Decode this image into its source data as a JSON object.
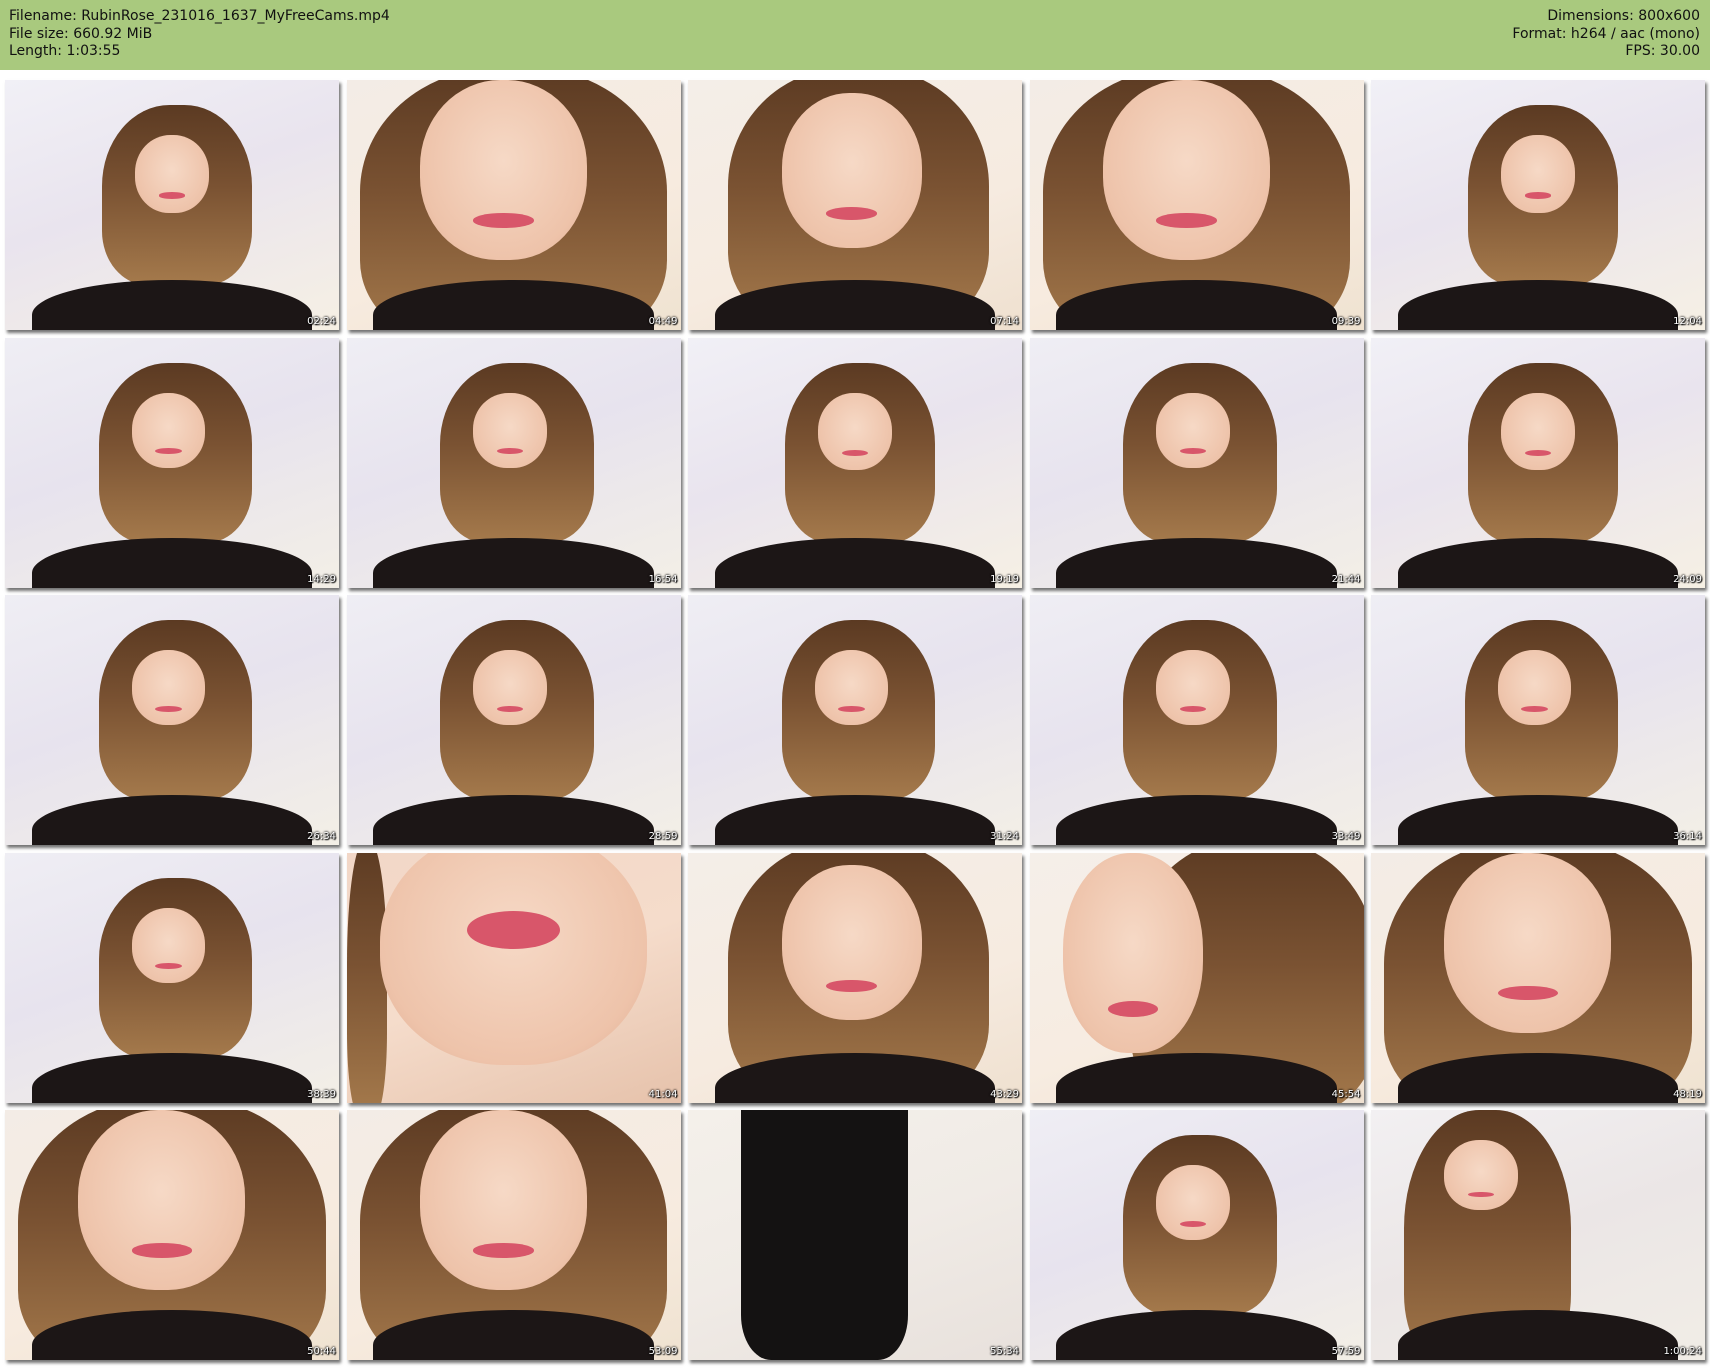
{
  "header": {
    "left_lines": [
      "Filename: RubinRose_231016_1637_MyFreeCams.mp4",
      "File size: 660.92 MiB",
      "Length: 1:03:55"
    ],
    "right_lines": [
      "Dimensions: 800x600",
      "Format: h264 / aac (mono)",
      "FPS: 30.00"
    ],
    "background_color": "#a9c97e"
  },
  "grid": {
    "columns": 5,
    "thumbnails": [
      {
        "timestamp": "02:24",
        "scene": "wide-smile"
      },
      {
        "timestamp": "04:49",
        "scene": "close-smile"
      },
      {
        "timestamp": "07:14",
        "scene": "close-talk"
      },
      {
        "timestamp": "09:39",
        "scene": "close-smile"
      },
      {
        "timestamp": "12:04",
        "scene": "wide-smile"
      },
      {
        "timestamp": "14:29",
        "scene": "wide"
      },
      {
        "timestamp": "16:54",
        "scene": "wide"
      },
      {
        "timestamp": "19:19",
        "scene": "wide-smile"
      },
      {
        "timestamp": "21:44",
        "scene": "wide"
      },
      {
        "timestamp": "24:09",
        "scene": "wide-smile"
      },
      {
        "timestamp": "26:34",
        "scene": "wide"
      },
      {
        "timestamp": "28:59",
        "scene": "wide"
      },
      {
        "timestamp": "31:24",
        "scene": "wide"
      },
      {
        "timestamp": "33:49",
        "scene": "wide"
      },
      {
        "timestamp": "36:14",
        "scene": "wide"
      },
      {
        "timestamp": "38:39",
        "scene": "wide"
      },
      {
        "timestamp": "41:04",
        "scene": "lips-closeup"
      },
      {
        "timestamp": "43:29",
        "scene": "close-talk"
      },
      {
        "timestamp": "45:54",
        "scene": "close-profile"
      },
      {
        "timestamp": "48:19",
        "scene": "close-smile"
      },
      {
        "timestamp": "50:44",
        "scene": "close-smile"
      },
      {
        "timestamp": "53:09",
        "scene": "close-smile"
      },
      {
        "timestamp": "55:34",
        "scene": "standing-legs"
      },
      {
        "timestamp": "57:59",
        "scene": "wide"
      },
      {
        "timestamp": "1:00:24",
        "scene": "leaning"
      }
    ]
  }
}
